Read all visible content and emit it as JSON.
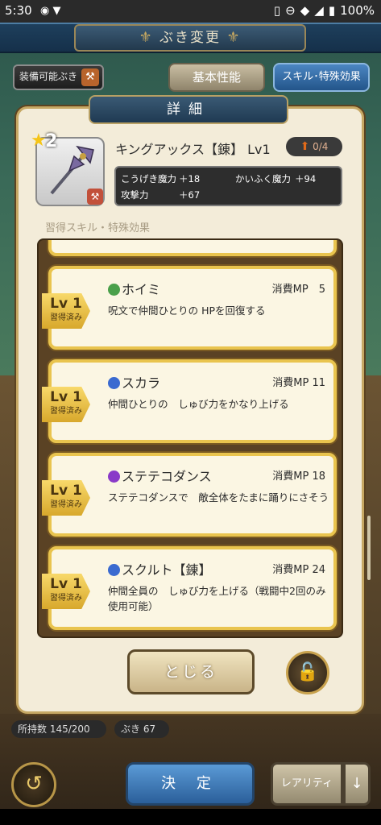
{
  "status_bar": {
    "time": "5:30",
    "battery": "100%"
  },
  "screen_title": "ぶき変更",
  "top_buttons": {
    "equippable": "装備可能ぶき",
    "basic": "基本性能",
    "skill": "スキル･特殊効果"
  },
  "dialog": {
    "title": "詳細",
    "stars": "2",
    "weapon_name": "キングアックス【錬】 Lv1",
    "level_badge": "0/4",
    "stats": [
      {
        "label": "こうげき魔力",
        "value": "＋18"
      },
      {
        "label": "かいふく魔力",
        "value": "＋94"
      },
      {
        "label": "攻撃力",
        "value": "＋67"
      }
    ],
    "section_label": "習得スキル・特殊効果",
    "skills": [
      {
        "level": "Lv 1",
        "status": "習得済み",
        "name": "ホイミ",
        "mp": "消費MP　5",
        "desc": "呪文で仲間ひとりの HPを回復する",
        "dot_color": "#4aa04a"
      },
      {
        "level": "Lv 1",
        "status": "習得済み",
        "name": "スカラ",
        "mp": "消費MP 11",
        "desc": "仲間ひとりの　しゅび力をかなり上げる",
        "dot_color": "#3a6ad0"
      },
      {
        "level": "Lv 1",
        "status": "習得済み",
        "name": "ステテコダンス",
        "mp": "消費MP 18",
        "desc": "ステテコダンスで　敵全体をたまに踊りにさそう",
        "dot_color": "#8a3ac8"
      },
      {
        "level": "Lv 1",
        "status": "習得済み",
        "name": "スクルト【錬】",
        "mp": "消費MP 24",
        "desc": "仲間全員の　しゅび力を上げる（戦闘中2回のみ使用可能）",
        "dot_color": "#3a6ad0"
      }
    ],
    "close_label": "とじる"
  },
  "footer": {
    "owned": "所持数 145/200",
    "buki": "ぶき 67",
    "confirm": "決 定",
    "rarity": "レアリティ",
    "sort_arrow": "↓"
  }
}
